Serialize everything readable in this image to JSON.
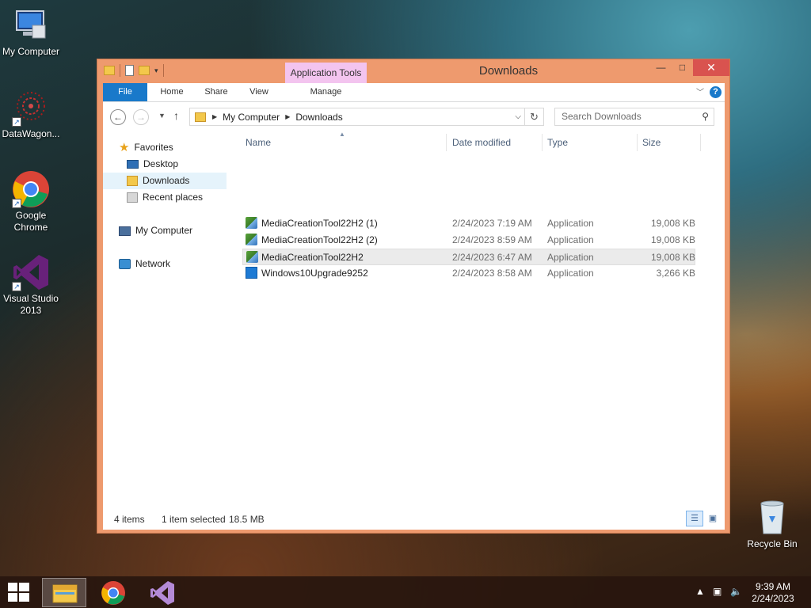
{
  "desktop": {
    "icons": [
      {
        "label": "My Computer",
        "icon": "computer-icon"
      },
      {
        "label": "DataWagon...",
        "icon": "datawagon-icon"
      },
      {
        "label": "Google Chrome",
        "icon": "chrome-icon"
      },
      {
        "label": "Visual Studio 2013",
        "icon": "visual-studio-icon"
      },
      {
        "label": "Recycle Bin",
        "icon": "recycle-bin-icon"
      }
    ]
  },
  "window": {
    "title": "Downloads",
    "context_tab": "Application Tools",
    "controls": {
      "minimize": "—",
      "maximize": "□",
      "close": "✕"
    },
    "ribbon": {
      "tabs": [
        "File",
        "Home",
        "Share",
        "View",
        "Manage"
      ],
      "active_tab": "File"
    },
    "address": {
      "breadcrumb": [
        "My Computer",
        "Downloads"
      ],
      "search_placeholder": "Search Downloads"
    },
    "nav_pane": {
      "favorites_label": "Favorites",
      "favorites": [
        "Desktop",
        "Downloads",
        "Recent places"
      ],
      "selected": "Downloads",
      "my_computer": "My Computer",
      "network": "Network"
    },
    "columns": {
      "name": "Name",
      "date": "Date modified",
      "type": "Type",
      "size": "Size"
    },
    "files": [
      {
        "name": "MediaCreationTool22H2 (1)",
        "date": "2/24/2023 7:19 AM",
        "type": "Application",
        "size": "19,008 KB",
        "icon": "media-creation-tool-icon",
        "selected": false
      },
      {
        "name": "MediaCreationTool22H2 (2)",
        "date": "2/24/2023 8:59 AM",
        "type": "Application",
        "size": "19,008 KB",
        "icon": "media-creation-tool-icon",
        "selected": false
      },
      {
        "name": "MediaCreationTool22H2",
        "date": "2/24/2023 6:47 AM",
        "type": "Application",
        "size": "19,008 KB",
        "icon": "media-creation-tool-icon",
        "selected": true
      },
      {
        "name": "Windows10Upgrade9252",
        "date": "2/24/2023 8:58 AM",
        "type": "Application",
        "size": "3,266 KB",
        "icon": "windows-upgrade-icon",
        "selected": false
      }
    ],
    "status": {
      "items": "4 items",
      "selection": "1 item selected",
      "size": "18.5 MB"
    }
  },
  "taskbar": {
    "time": "9:39 AM",
    "date": "2/24/2023",
    "pinned": [
      "file-explorer-icon",
      "chrome-icon",
      "visual-studio-icon"
    ],
    "active": "file-explorer-icon"
  },
  "colors": {
    "window_frame": "#ee9a6e",
    "file_tab": "#1979ca",
    "context_tab": "#f3c4ef",
    "close_button": "#d9534f"
  }
}
